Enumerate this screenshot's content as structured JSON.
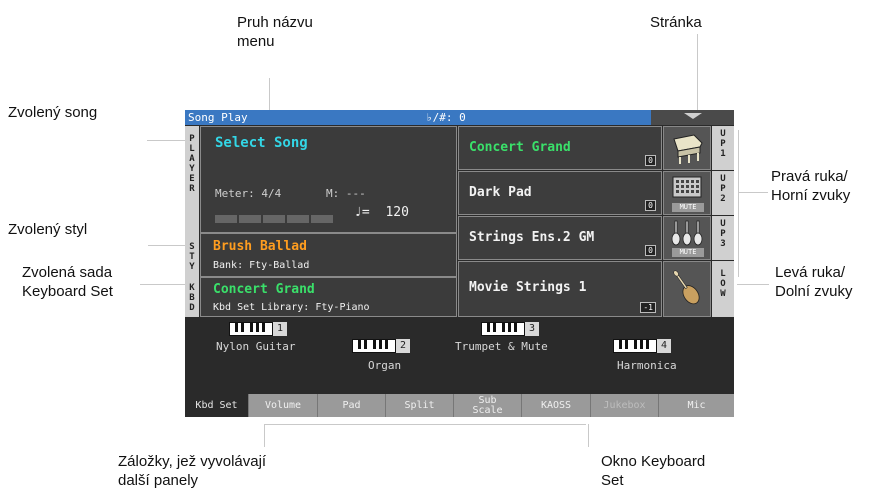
{
  "annotations": {
    "menu_bar_line1": "Pruh názvu",
    "menu_bar_line2": "menu",
    "page": "Stránka",
    "selected_song": "Zvolený song",
    "right_hand_line1": "Pravá ruka/",
    "right_hand_line2": "Horní zvuky",
    "selected_style": "Zvolený styl",
    "kbd_set_line1": "Zvolená sada",
    "kbd_set_line2": "Keyboard Set",
    "left_hand_line1": "Levá ruka/",
    "left_hand_line2": "Dolní zvuky",
    "tabs_line1": "Záložky, jež vyvolávají",
    "tabs_line2": "další panely",
    "kbd_window_line1": "Okno Keyboard",
    "kbd_window_line2": "Set"
  },
  "screen": {
    "title": "Song Play",
    "transpose": "♭/#: 0",
    "page_menu_icon": "chevron-down-icon",
    "player": {
      "tab_label": "PLAYER",
      "song_name": "Select Song",
      "meter_label": "Meter:",
      "meter_value": "4/4",
      "measure_label": "M:",
      "measure_value": "---",
      "tempo_symbol": "♩=",
      "tempo_value": "120"
    },
    "style": {
      "tab_label": "STY",
      "name": "Brush Ballad",
      "bank_label": "Bank:",
      "bank_value": "Fty-Ballad"
    },
    "kbd": {
      "tab_label": "KBD",
      "name": "Concert Grand",
      "library_label": "Kbd Set Library:",
      "library_value": "Fty-Piano"
    },
    "sounds": [
      {
        "name": "Concert Grand",
        "icon": "piano-icon",
        "track": "UP1",
        "muted": false,
        "color": "#3ae06a"
      },
      {
        "name": "Dark Pad",
        "icon": "synth-pad-icon",
        "track": "UP2",
        "muted": true,
        "color": "#f2f2f2"
      },
      {
        "name": "Strings Ens.2 GM",
        "icon": "violins-icon",
        "track": "UP3",
        "muted": true,
        "color": "#f2f2f2"
      },
      {
        "name": "Movie Strings 1",
        "icon": "cello-icon",
        "track": "LOW",
        "muted": false,
        "color": "#f2f2f2"
      }
    ],
    "mute_label": "MUTE",
    "kbd_sets": [
      {
        "num": "1",
        "name": "Nylon Guitar"
      },
      {
        "num": "2",
        "name": "Organ"
      },
      {
        "num": "3",
        "name": "Trumpet & Mute"
      },
      {
        "num": "4",
        "name": "Harmonica"
      }
    ],
    "tabs": [
      {
        "label": "Kbd Set",
        "active": true,
        "disabled": false
      },
      {
        "label": "Volume",
        "active": false,
        "disabled": false
      },
      {
        "label": "Pad",
        "active": false,
        "disabled": false
      },
      {
        "label": "Split",
        "active": false,
        "disabled": false
      },
      {
        "label": "Sub Scale",
        "active": false,
        "disabled": false
      },
      {
        "label": "KAOSS",
        "active": false,
        "disabled": false
      },
      {
        "label": "Jukebox",
        "active": false,
        "disabled": true
      },
      {
        "label": "Mic",
        "active": false,
        "disabled": false
      }
    ]
  }
}
